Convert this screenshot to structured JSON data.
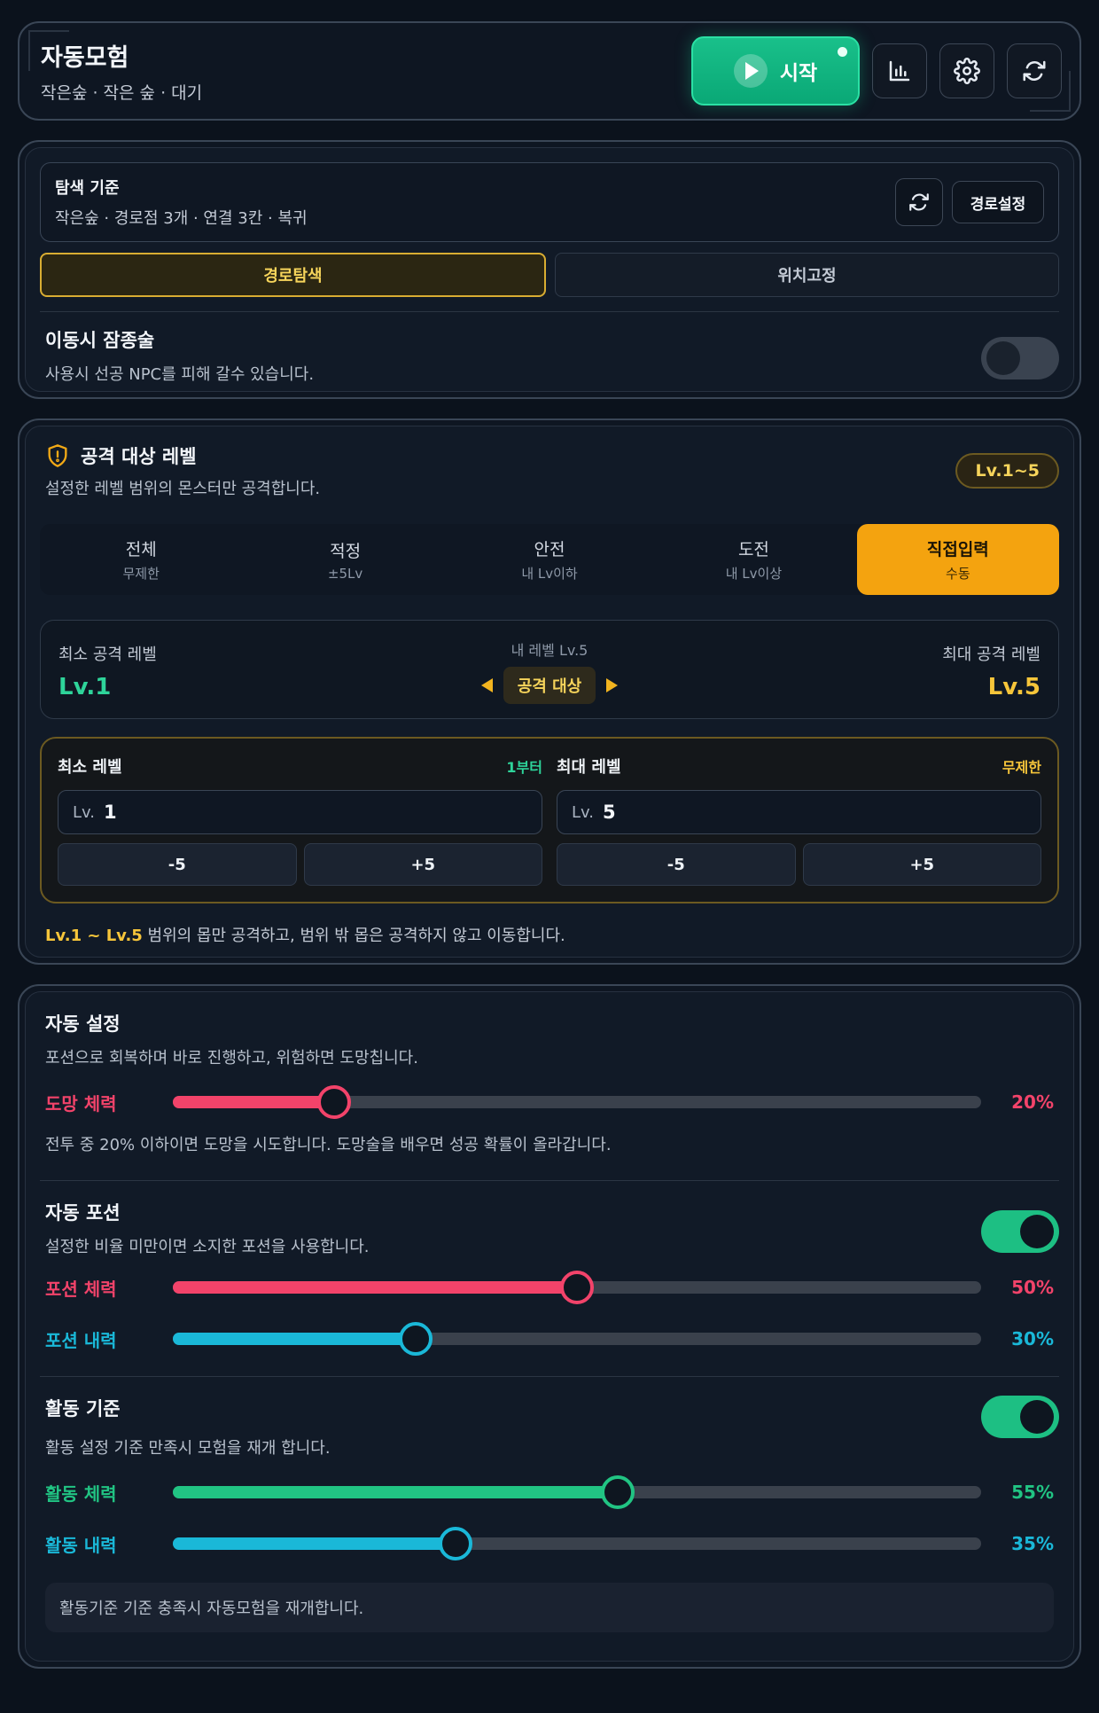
{
  "header": {
    "title": "자동모험",
    "subtitle": "작은숲 · 작은 숲 · 대기",
    "start_label": "시작"
  },
  "route": {
    "criteria_title": "탐색 기준",
    "criteria_sub": "작은숲 · 경로점 3개 · 연결 3칸 · 복귀",
    "route_setting_label": "경로설정",
    "mode_tabs": [
      "경로탐색",
      "위치고정"
    ],
    "selected_mode": "경로탐색",
    "stealth_title": "이동시 잠종술",
    "stealth_desc": "사용시 선공 NPC를 피해 갈수 있습니다.",
    "stealth_enabled": false
  },
  "level": {
    "title": "공격 대상 레벨",
    "desc": "설정한 레벨 범위의 몬스터만 공격합니다.",
    "badge": "Lv.1~5",
    "tabs": [
      {
        "label": "전체",
        "sub": "무제한"
      },
      {
        "label": "적정",
        "sub": "±5Lv"
      },
      {
        "label": "안전",
        "sub": "내 Lv이하"
      },
      {
        "label": "도전",
        "sub": "내 Lv이상"
      },
      {
        "label": "직접입력",
        "sub": "수동"
      }
    ],
    "selected_tab": "직접입력",
    "min_label": "최소 공격 레벨",
    "min_value": "Lv.1",
    "my_level": "내 레벨 Lv.5",
    "target_label": "공격 대상",
    "max_label": "최대 공격 레벨",
    "max_value": "Lv.5",
    "manual_min": {
      "title": "최소 레벨",
      "hint": "1부터",
      "prefix": "Lv.",
      "value": "1",
      "dec": "-5",
      "inc": "+5"
    },
    "manual_max": {
      "title": "최대 레벨",
      "hint": "무제한",
      "prefix": "Lv.",
      "value": "5",
      "dec": "-5",
      "inc": "+5"
    },
    "summary_range": "Lv.1 ~ Lv.5",
    "summary_text": " 범위의 몹만 공격하고, 범위 밖 몹은 공격하지 않고 이동합니다."
  },
  "auto": {
    "title": "자동 설정",
    "desc": "포션으로 회복하며 바로 진행하고, 위험하면 도망칩니다.",
    "flee": {
      "label": "도망 체력",
      "value": 20,
      "pct": "20%",
      "color": "#f2436a"
    },
    "flee_desc": "전투 중 20% 이하이면 도망을 시도합니다. 도망술을 배우면 성공 확률이 올라갑니다.",
    "potion_title": "자동 포션",
    "potion_desc": "설정한 비율 미만이면 소지한 포션을 사용합니다.",
    "potion_enabled": true,
    "potion_hp": {
      "label": "포션 체력",
      "value": 50,
      "pct": "50%",
      "color": "#f2436a"
    },
    "potion_mp": {
      "label": "포션 내력",
      "value": 30,
      "pct": "30%",
      "color": "#1ab8d8"
    },
    "activity_title": "활동 기준",
    "activity_desc": "활동 설정 기준 만족시 모험을 재개 합니다.",
    "activity_enabled": true,
    "activity_hp": {
      "label": "활동 체력",
      "value": 55,
      "pct": "55%",
      "color": "#21c483"
    },
    "activity_mp": {
      "label": "활동 내력",
      "value": 35,
      "pct": "35%",
      "color": "#1ab8d8"
    },
    "note": "활동기준 기준 충족시 자동모험을 재개합니다."
  }
}
